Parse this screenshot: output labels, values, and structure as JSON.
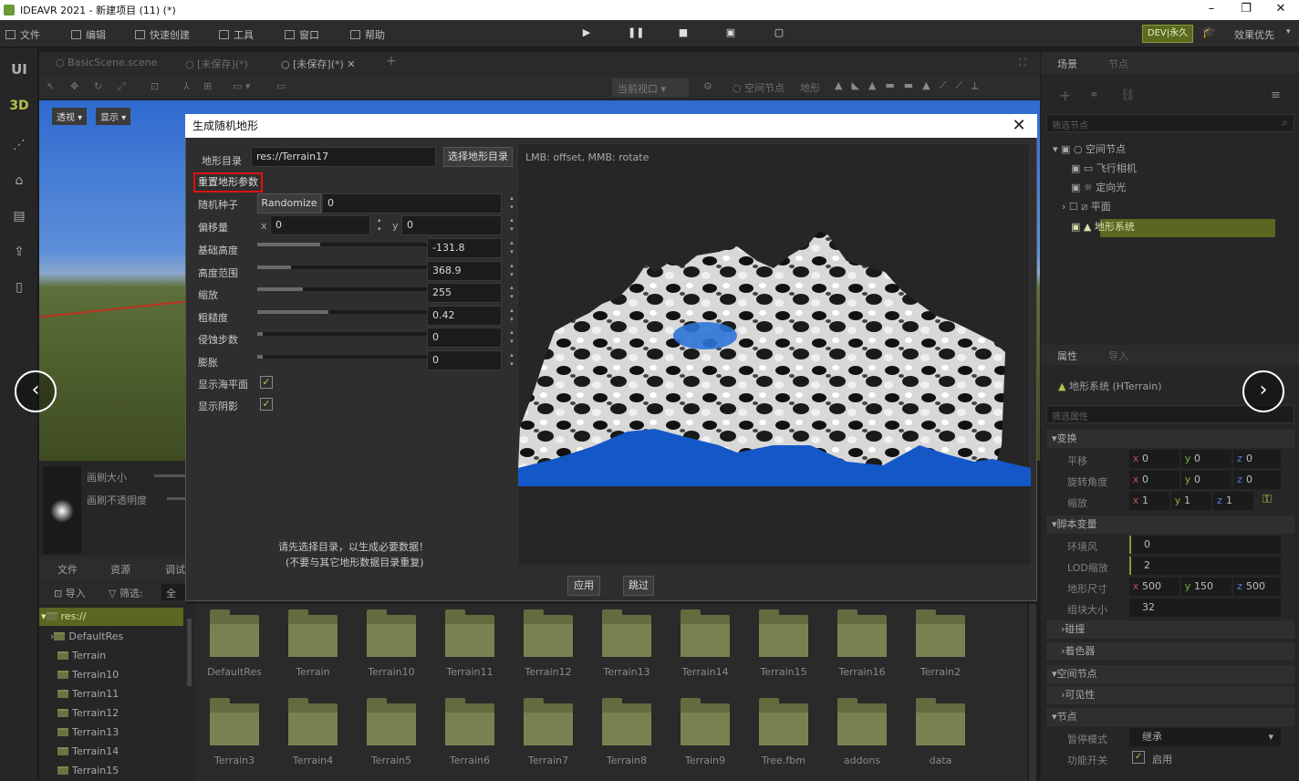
{
  "window": {
    "title": "IDEAVR 2021 - 新建项目 (11) (*)",
    "min": "–",
    "max": "❐",
    "close": "✕"
  },
  "menu": {
    "file": "文件",
    "edit": "编辑",
    "quick": "快速创建",
    "tools": "工具",
    "window": "窗口",
    "help": "帮助",
    "dev": "DEV|永久",
    "perf": "效果优先"
  },
  "left_modes": {
    "ui": "UI",
    "threed": "3D"
  },
  "scene_tabs": [
    "BasicScene.scene",
    "[未保存](*)",
    "[未保存](*)"
  ],
  "toolbar2": {
    "viewport": "当前视口",
    "space_node": "空间节点",
    "terrain": "地形"
  },
  "viewport": {
    "perspective": "透视",
    "show": "显示"
  },
  "brush": {
    "size": "画刷大小",
    "opacity": "画刷不透明度"
  },
  "bottom": {
    "tab_files": "文件",
    "tab_res": "资源",
    "tab_debug": "调试",
    "import": "导入",
    "filter": "筛选:",
    "all": "全部"
  },
  "tree": {
    "root": "res://",
    "items": [
      "DefaultRes",
      "Terrain",
      "Terrain10",
      "Terrain11",
      "Terrain12",
      "Terrain13",
      "Terrain14",
      "Terrain15"
    ]
  },
  "files_row1": [
    "DefaultRes",
    "Terrain",
    "Terrain10",
    "Terrain11",
    "Terrain12",
    "Terrain13",
    "Terrain14",
    "Terrain15",
    "Terrain16",
    "Terrain2"
  ],
  "files_row2": [
    "Terrain3",
    "Terrain4",
    "Terrain5",
    "Terrain6",
    "Terrain7",
    "Terrain8",
    "Terrain9",
    "Tree.fbm",
    "addons",
    "data"
  ],
  "right": {
    "tab_scene": "场景",
    "tab_node": "节点",
    "filter_nodes": "筛选节点",
    "nodes": [
      "空间节点",
      "飞行相机",
      "定向光",
      "平面",
      "地形系统"
    ],
    "tab_props": "属性",
    "tab_import": "导入",
    "obj": "地形系统 (HTerrain)",
    "filter_props": "筛选属性",
    "transform": "变换",
    "translate": "平移",
    "rotate": "旋转角度",
    "scale": "缩放",
    "vals": {
      "x": "x",
      "y": "y",
      "z": "z",
      "zero": "0",
      "one": "1"
    },
    "script_vars": "脚本变量",
    "ambient": "环境风",
    "ambient_v": "0",
    "lod": "LOD缩放",
    "lod_v": "2",
    "tsize": "地形尺寸",
    "tsx": "500",
    "tsy": "150",
    "tsz": "500",
    "chunk": "组块大小",
    "chunk_v": "32",
    "collision": "碰撞",
    "shader": "着色器",
    "space": "空间节点",
    "visible": "可见性",
    "nodesec": "节点",
    "pause": "暂停模式",
    "pause_v": "继承",
    "toggle": "功能开关",
    "enable": "启用"
  },
  "dialog": {
    "title": "生成随机地形",
    "dir_label": "地形目录",
    "dir_value": "res://Terrain17",
    "choose_dir": "选择地形目录",
    "reset": "重置地形参数",
    "seed": "随机种子",
    "randomize": "Randomize",
    "seed_v": "0",
    "offset": "偏移量",
    "ox": "x",
    "ox_v": "0",
    "oy": "y",
    "oy_v": "0",
    "params": [
      {
        "label": "基础高度",
        "value": "-131.8",
        "fill": 0.37
      },
      {
        "label": "高度范围",
        "value": "368.9",
        "fill": 0.2
      },
      {
        "label": "缩放",
        "value": "255",
        "fill": 0.27
      },
      {
        "label": "粗糙度",
        "value": "0.42",
        "fill": 0.42
      },
      {
        "label": "侵蚀步数",
        "value": "0",
        "fill": 0.03
      },
      {
        "label": "膨胀",
        "value": "0",
        "fill": 0.03
      }
    ],
    "show_sea": "显示海平面",
    "show_shadow": "显示阴影",
    "hint1": "请先选择目录，以生成必要数据！",
    "hint2": "(不要与其它地形数据目录重复)",
    "preview_hint": "LMB: offset, MMB: rotate",
    "apply": "应用",
    "skip": "跳过"
  },
  "nav": {
    "prev": "‹",
    "next": "›"
  }
}
